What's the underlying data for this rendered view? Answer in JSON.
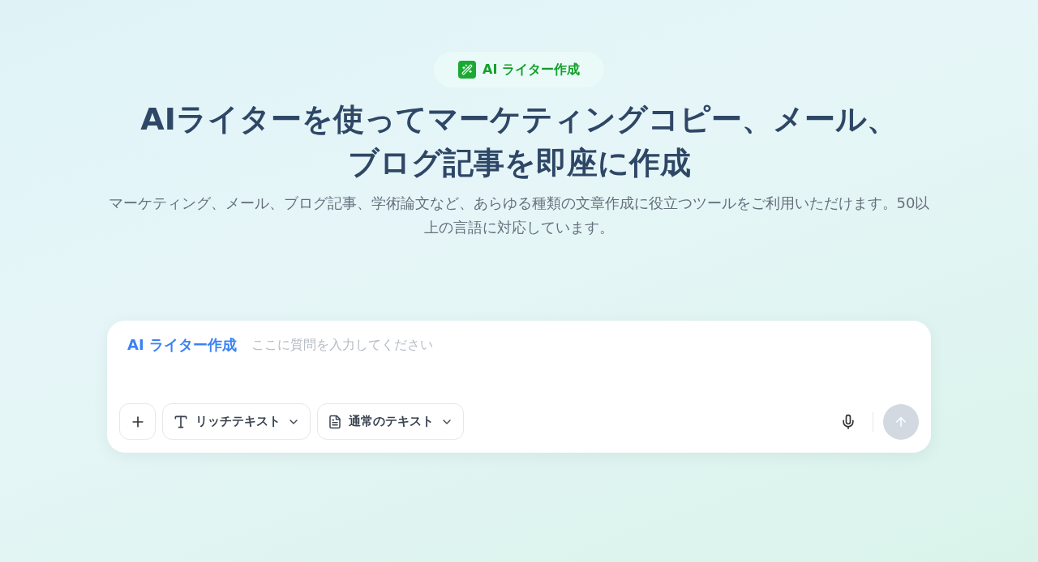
{
  "badge": {
    "label": "AI ライター作成"
  },
  "heading": "AIライターを使ってマーケティングコピー、メール、ブログ記事を即座に作成",
  "subtitle": "マーケティング、メール、ブログ記事、学術論文など、あらゆる種類の文章作成に役立つツールをご利用いただけます。50以上の言語に対応しています。",
  "composer": {
    "label": "AI ライター作成",
    "placeholder": "ここに質問を入力してください",
    "toolbar": [
      {
        "kind": "add"
      },
      {
        "kind": "text-format",
        "label": "リッチテキスト"
      },
      {
        "kind": "document-format",
        "label": "通常のテキスト"
      }
    ],
    "send": {
      "disabled": true
    }
  }
}
